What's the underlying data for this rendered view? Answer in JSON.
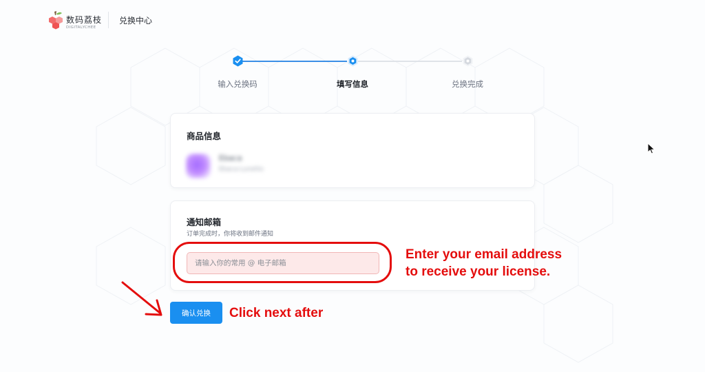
{
  "header": {
    "logo_name": "数码荔枝",
    "logo_sub": "DIGITALYCHEE",
    "title": "兑换中心"
  },
  "stepper": {
    "steps": [
      {
        "label": "输入兑换码",
        "state": "completed"
      },
      {
        "label": "填写信息",
        "state": "active"
      },
      {
        "label": "兑换完成",
        "state": "pending"
      }
    ]
  },
  "product_card": {
    "title": "商品信息",
    "item_name": "Ebaca",
    "item_desc": "Ebaca·Lunetto"
  },
  "email_card": {
    "title": "通知邮箱",
    "subtitle": "订单完成时，你将收到邮件通知",
    "input_placeholder": "请输入你的常用 @ 电子邮箱",
    "input_value": ""
  },
  "confirm_button": {
    "label": "确认兑换"
  },
  "annotations": {
    "email_hint_line1": "Enter your email address",
    "email_hint_line2": "to receive your license.",
    "next_hint": "Click next after"
  },
  "colors": {
    "accent": "#1a8ff0",
    "progress": "#3b8fe6",
    "annotation_red": "#e40d0d",
    "input_error_bg": "#fde9e9"
  },
  "icons": {
    "logo": "lychee-logo-icon",
    "step_completed": "check-shield-icon",
    "step_active": "hexagon-dot-icon",
    "step_pending": "hexagon-dot-icon",
    "cursor": "mouse-pointer-icon",
    "arrow": "arrow-down-right-icon"
  }
}
